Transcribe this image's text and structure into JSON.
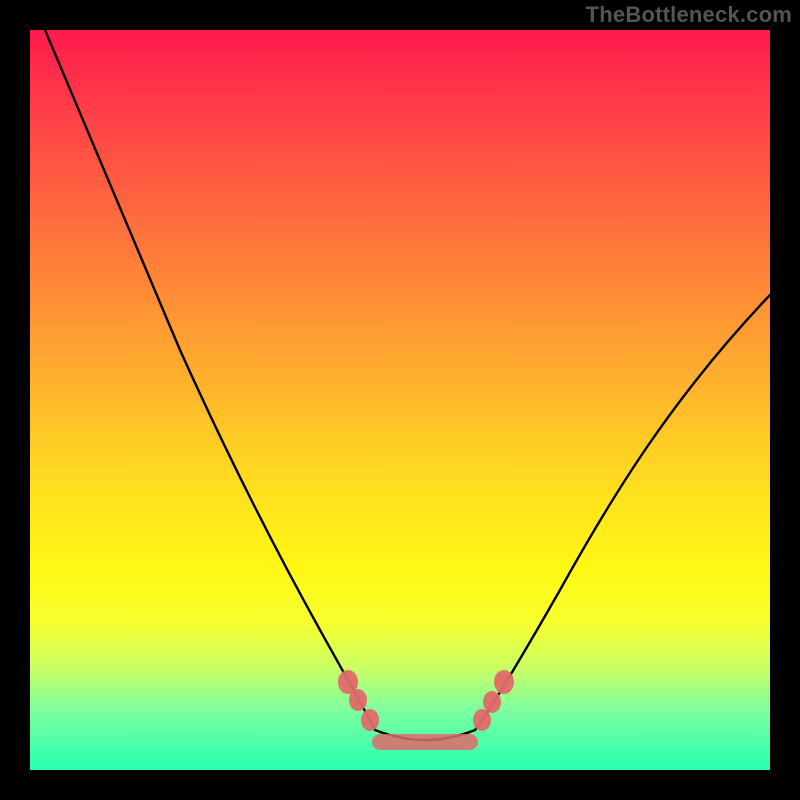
{
  "attribution": "TheBottleneck.com",
  "colors": {
    "page_bg": "#000000",
    "marker": "#e06a6a",
    "curve": "#000000",
    "gradient_stops": [
      "#ff1a4d",
      "#ff3b49",
      "#ff6a3e",
      "#ff9a33",
      "#ffc029",
      "#ffe21e",
      "#fff814",
      "#f8ff2e",
      "#ccff63",
      "#7dffa0",
      "#26ffb0"
    ]
  },
  "chart_data": {
    "type": "line",
    "title": "",
    "xlabel": "",
    "ylabel": "",
    "xlim": [
      0,
      100
    ],
    "ylim": [
      0,
      100
    ],
    "series": [
      {
        "name": "left-curve",
        "x": [
          2,
          5,
          10,
          15,
          20,
          25,
          30,
          35,
          40,
          44,
          46
        ],
        "y": [
          100,
          92,
          80,
          68,
          56,
          45,
          34,
          24,
          14,
          6,
          4
        ]
      },
      {
        "name": "right-curve",
        "x": [
          60,
          63,
          67,
          72,
          78,
          84,
          90,
          96,
          100
        ],
        "y": [
          4,
          6,
          10,
          15,
          22,
          31,
          42,
          55,
          64
        ]
      }
    ],
    "annotations": {
      "flat_minimum_range_x": [
        46,
        60
      ],
      "markers_left": [
        {
          "x": 43,
          "y": 9
        },
        {
          "x": 44.5,
          "y": 6.5
        },
        {
          "x": 46,
          "y": 5
        }
      ],
      "markers_right": [
        {
          "x": 60,
          "y": 5
        },
        {
          "x": 61.5,
          "y": 6.5
        },
        {
          "x": 63,
          "y": 8.5
        }
      ],
      "bottom_bar_y": 4
    },
    "notes": "Bottleneck-style curve: two descending/ascending lines converging into a flat minimum region near y≈4% between x≈46 and x≈60; pink markers dot the transition into the flat region and a pink bar spans the flat minimum."
  }
}
